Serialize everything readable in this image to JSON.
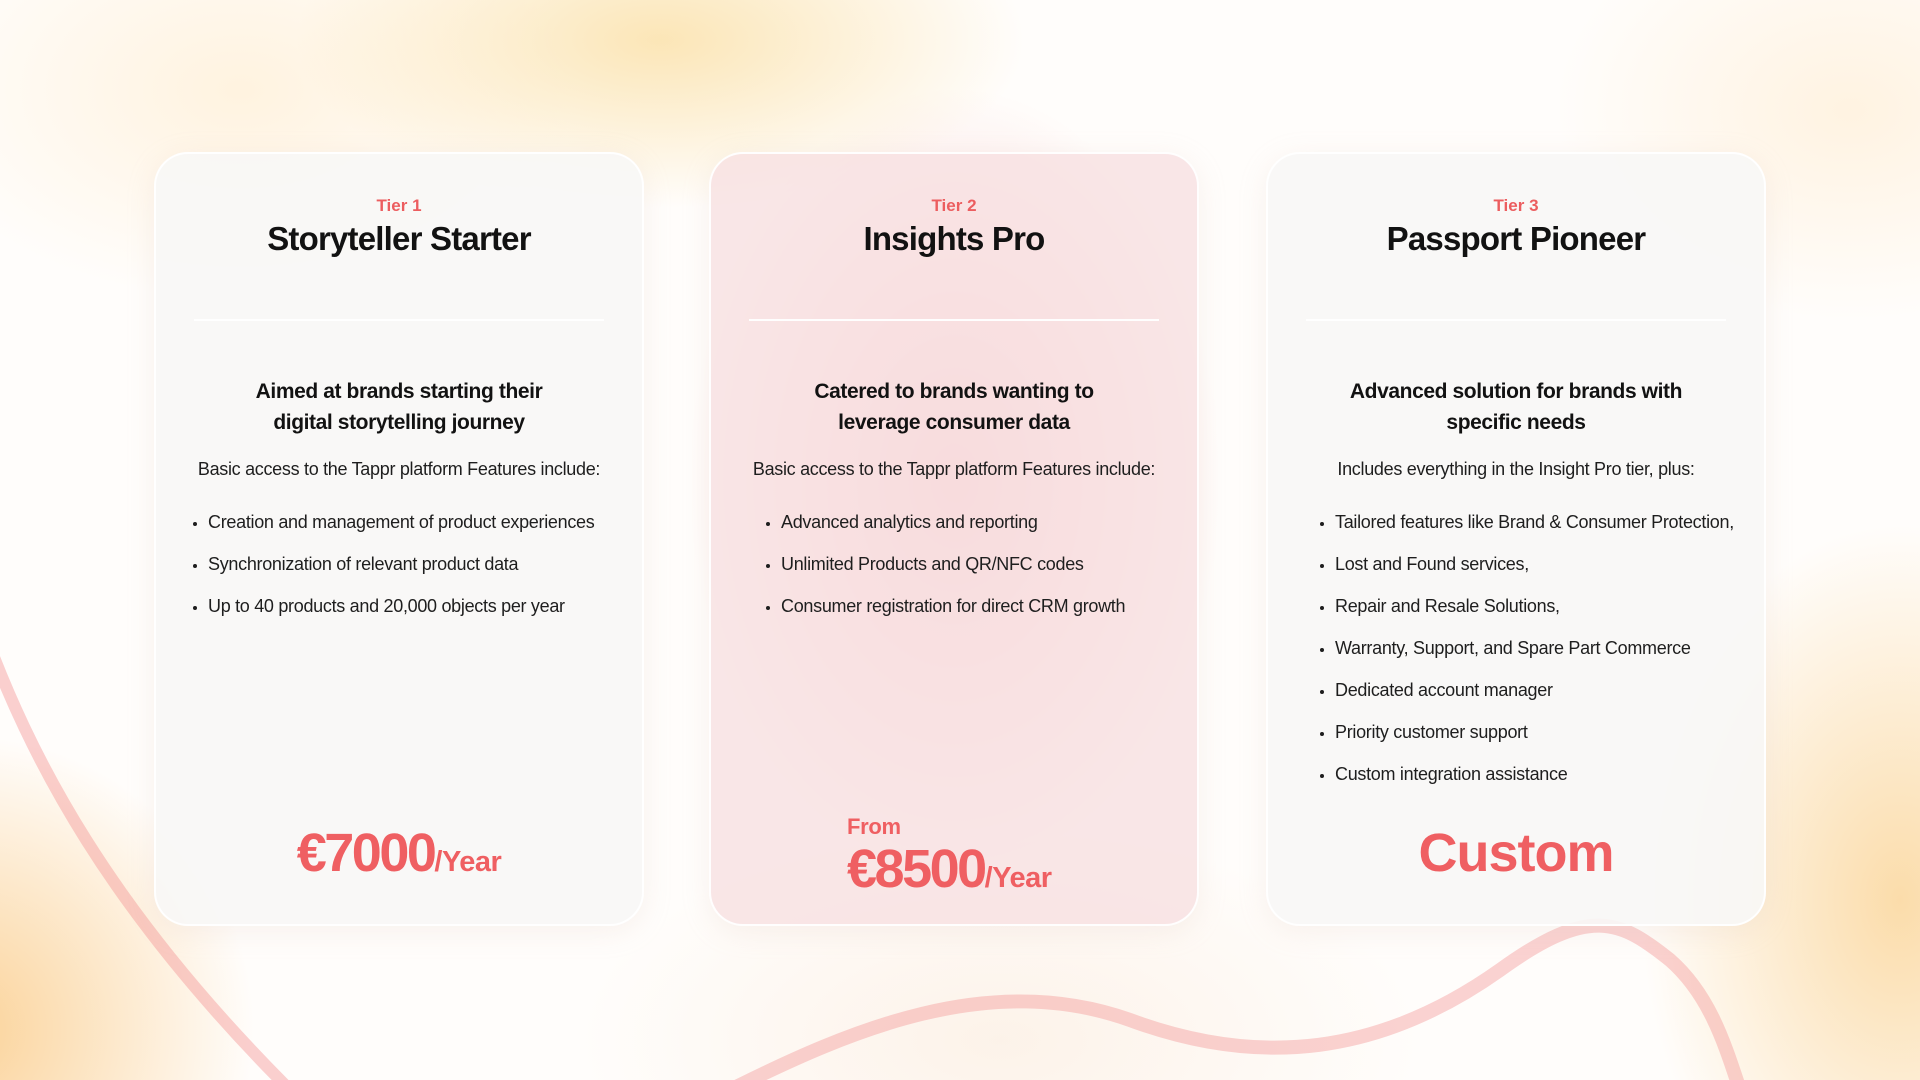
{
  "theme": {
    "accent": "#ef5f62",
    "text": "#121212",
    "card_background": "#f8f7f6",
    "featured_card_background": "#f8e0e2"
  },
  "tiers": [
    {
      "tier_label": "Tier 1",
      "name": "Storyteller Starter",
      "subtitle": [
        "Aimed at brands starting their",
        "digital storytelling journey"
      ],
      "intro": "Basic access to the Tappr platform Features include:",
      "features": [
        "Creation and management of product experiences",
        "Synchronization of relevant product data",
        "Up to 40 products and 20,000 objects per year"
      ],
      "price_prefix": "",
      "price": "€7000",
      "price_period": "/Year"
    },
    {
      "tier_label": "Tier 2",
      "name": "Insights Pro",
      "subtitle": [
        "Catered to brands wanting to",
        "leverage consumer data"
      ],
      "intro": "Basic access to the Tappr platform Features include:",
      "features": [
        "Advanced analytics and reporting",
        "Unlimited Products and QR/NFC codes",
        "Consumer registration for direct CRM growth"
      ],
      "price_prefix": "From",
      "price": "€8500",
      "price_period": "/Year"
    },
    {
      "tier_label": "Tier 3",
      "name": "Passport Pioneer",
      "subtitle": [
        "Advanced solution for brands with",
        "specific needs"
      ],
      "intro": "Includes everything in the Insight Pro tier, plus:",
      "features": [
        "Tailored features like Brand & Consumer Protection,",
        "Lost and Found services,",
        "Repair and Resale Solutions,",
        "Warranty, Support, and Spare Part Commerce",
        "Dedicated account manager",
        "Priority customer support",
        "Custom integration assistance"
      ],
      "price_prefix": "",
      "price": "Custom",
      "price_period": ""
    }
  ]
}
